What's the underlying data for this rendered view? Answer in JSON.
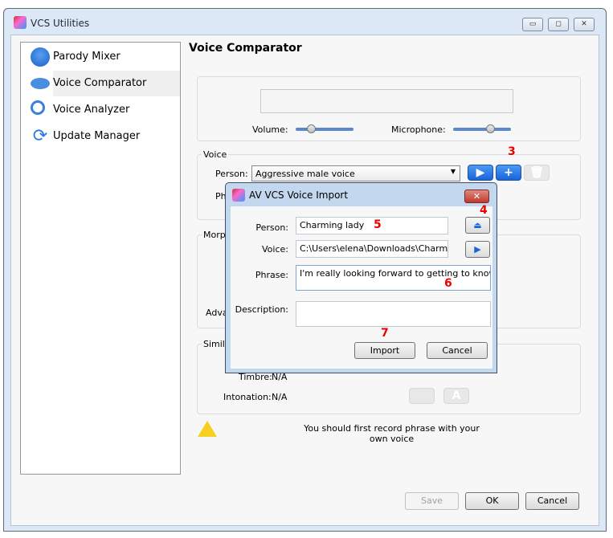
{
  "window": {
    "title": "VCS Utilities",
    "icon": "app-faces-icon",
    "controls": [
      "minimize",
      "maximize",
      "close"
    ]
  },
  "sidebar": {
    "items": [
      {
        "label": "Parody Mixer",
        "icon": "face-icon"
      },
      {
        "label": "Voice Comparator",
        "icon": "lips-icon",
        "selected": true
      },
      {
        "label": "Voice Analyzer",
        "icon": "magnifier-wave-icon"
      },
      {
        "label": "Update Manager",
        "icon": "refresh-arrows-icon"
      }
    ]
  },
  "main": {
    "title": "Voice Comparator",
    "volume_label": "Volume:",
    "volume_level": 0.3,
    "microphone_label": "Microphone:",
    "microphone_level": 0.65,
    "voice_group": {
      "label": "Voice",
      "person_label": "Person:",
      "person_value": "Aggressive male voice",
      "phrase_label_partial": "Ph"
    },
    "morph_group": {
      "label_partial": "Morph",
      "advanced_partial": "Adva"
    },
    "similarity_group": {
      "label_partial": "Simila",
      "timbre_label": "Timbre:",
      "timbre_value": "N/A",
      "intonation_label": "Intonation:",
      "intonation_value": "N/A"
    },
    "warning": "You should first record phrase with your own voice",
    "buttons": {
      "save": "Save",
      "ok": "OK",
      "cancel": "Cancel"
    }
  },
  "dialog": {
    "title": "AV VCS Voice Import",
    "person_label": "Person:",
    "person_value": "Charming lady",
    "voice_label": "Voice:",
    "voice_value": "C:\\Users\\elena\\Downloads\\Charminglady",
    "phrase_label": "Phrase:",
    "phrase_value": "I'm really looking forward to getting to know you",
    "description_label": "Description:",
    "description_value": "",
    "import": "Import",
    "cancel": "Cancel"
  },
  "annotations": {
    "a3": "3",
    "a4": "4",
    "a5": "5",
    "a6": "6",
    "a7": "7"
  },
  "colors": {
    "accent": "#1b63d8",
    "annotation": "#ee0000",
    "dialog_close": "#c94a40"
  }
}
